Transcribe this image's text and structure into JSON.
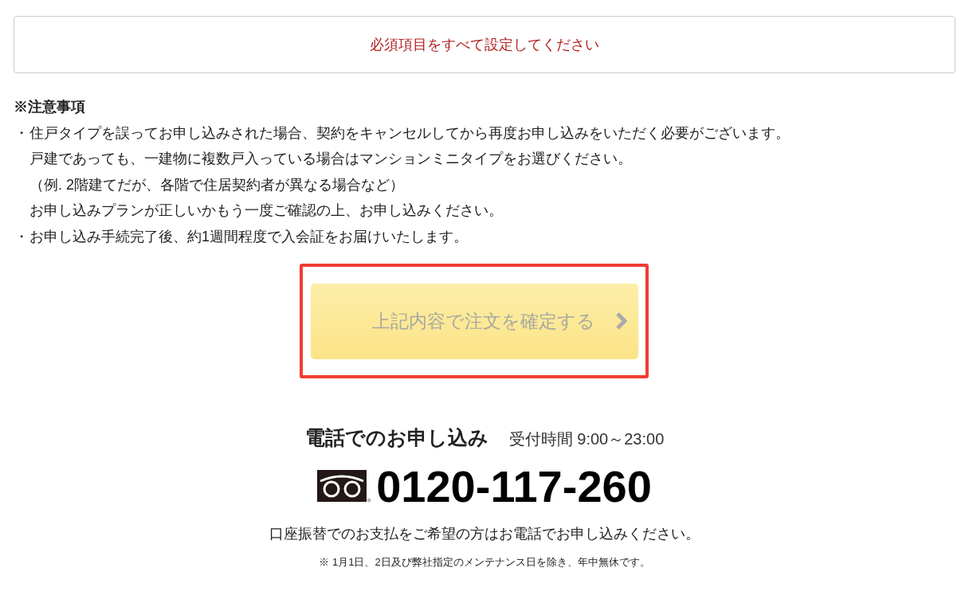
{
  "alert": {
    "message": "必須項目をすべて設定してください"
  },
  "notes": {
    "title": "※注意事項",
    "items": [
      {
        "bullet": "・",
        "lines": [
          "住戸タイプを誤ってお申し込みされた場合、契約をキャンセルしてから再度お申し込みをいただく必要がございます。",
          "戸建であっても、一建物に複数戸入っている場合はマンションミニタイプをお選びください。",
          "（例. 2階建てだが、各階で住居契約者が異なる場合など）",
          "お申し込みプランが正しいかもう一度ご確認の上、お申し込みください。"
        ]
      },
      {
        "bullet": "・",
        "lines": [
          "お申し込み手続完了後、約1週間程度で入会証をお届けいたします。"
        ]
      }
    ]
  },
  "confirm_button": {
    "label": "上記内容で注文を確定する",
    "disabled": true,
    "highlighted": true
  },
  "phone": {
    "heading": "電話でのお申し込み",
    "hours": "受付時間 9:00～23:00",
    "number": "0120-117-260",
    "payment_note": "口座振替でのお支払をご希望の方はお電話でお申し込みください。",
    "footnote": "※ 1月1日、2日及び弊社指定のメンテナンス日を除き、年中無休です。"
  }
}
